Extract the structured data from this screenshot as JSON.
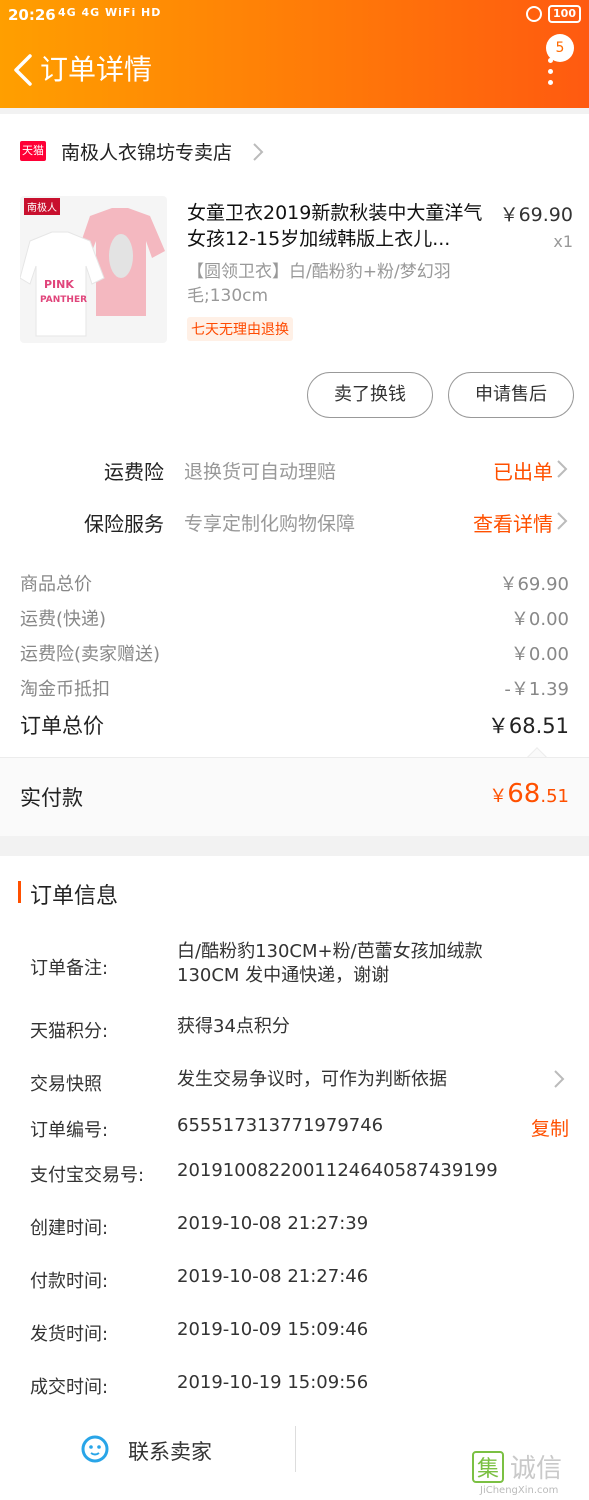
{
  "status_bar": {
    "time": "20:26",
    "icons": "4G 4G WiFi HD",
    "battery": "100"
  },
  "header": {
    "title": "订单详情",
    "badge_count": "5"
  },
  "shop": {
    "logo_text": "天猫",
    "name": "南极人衣锦坊专卖店"
  },
  "product": {
    "image_brand": "南极人",
    "title": "女童卫衣2019新款秋装中大童洋气女孩12-15岁加绒韩版上衣儿...",
    "price": "￥69.90",
    "quantity": "x1",
    "sku": "【圆领卫衣】白/酷粉豹+粉/梦幻羽毛;130cm",
    "tag": "七天无理由退换"
  },
  "actions": {
    "resell_label": "卖了换钱",
    "after_sale_label": "申请售后"
  },
  "services": [
    {
      "label": "运费险",
      "desc": "退换货可自动理赔",
      "action": "已出单"
    },
    {
      "label": "保险服务",
      "desc": "专享定制化购物保障",
      "action": "查看详情"
    }
  ],
  "fees": [
    {
      "label": "商品总价",
      "value": "￥69.90"
    },
    {
      "label": "运费(快递)",
      "value": "￥0.00"
    },
    {
      "label": "运费险(卖家赠送)",
      "value": "￥0.00"
    },
    {
      "label": "淘金币抵扣",
      "value": "-￥1.39"
    }
  ],
  "total": {
    "label": "订单总价",
    "value": "￥68.51"
  },
  "paid": {
    "label": "实付款",
    "currency": "￥",
    "integer": "68",
    "decimal": ".51"
  },
  "order_info": {
    "title": "订单信息",
    "rows": [
      {
        "label": "订单备注:",
        "value": "白/酷粉豹130CM+粉/芭蕾女孩加绒款130CM  发中通快递，谢谢"
      },
      {
        "label": "天猫积分:",
        "value": "获得34点积分"
      },
      {
        "label": "交易快照",
        "value": "发生交易争议时，可作为判断依据"
      },
      {
        "label": "订单编号:",
        "value": "655517313771979746"
      },
      {
        "label": "支付宝交易号:",
        "value": "2019100822001124640587439199"
      },
      {
        "label": "创建时间:",
        "value": "2019-10-08 21:27:39"
      },
      {
        "label": "付款时间:",
        "value": "2019-10-08 21:27:46"
      },
      {
        "label": "发货时间:",
        "value": "2019-10-09 15:09:46"
      },
      {
        "label": "成交时间:",
        "value": "2019-10-19 15:09:56"
      }
    ],
    "copy_label": "复制"
  },
  "contact": {
    "label": "联系卖家"
  },
  "watermark": {
    "text": "集诚信",
    "url_text": "JiChengXin.com"
  },
  "colors": {
    "accent": "#ff5000",
    "header_start": "#ff9f00",
    "header_end": "#ff5a10",
    "muted": "#999999"
  }
}
